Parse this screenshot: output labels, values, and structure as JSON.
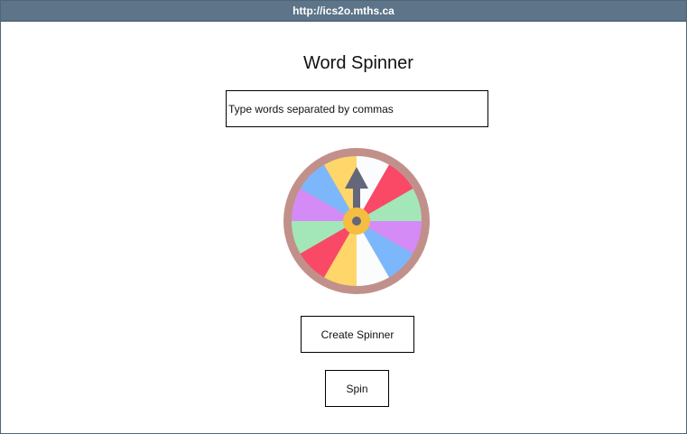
{
  "window": {
    "url": "http://ics2o.mths.ca"
  },
  "main": {
    "title": "Word Spinner",
    "words_input": {
      "placeholder": "Type words separated by commas",
      "value": ""
    },
    "create_button_label": "Create Spinner",
    "spin_button_label": "Spin"
  },
  "wheel": {
    "icon": "spinner-wheel-icon",
    "rim_color": "#c2908a",
    "hub_color": "#f5bd41",
    "pointer_color": "#636779",
    "segment_colors": [
      "#fbfcfd",
      "#fa4867",
      "#a3e7b9",
      "#d58bf5",
      "#7db7fb",
      "#fbfcfd",
      "#fed66a",
      "#fa4867",
      "#a3e7b9",
      "#d58bf5",
      "#7db7fb",
      "#fed66a"
    ]
  }
}
